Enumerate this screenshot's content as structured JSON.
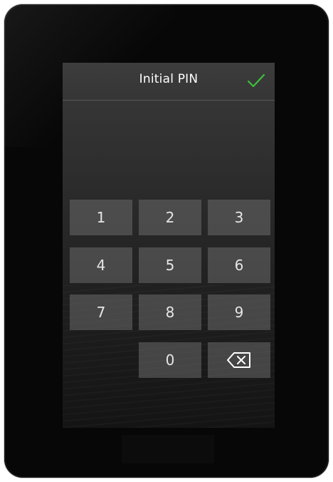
{
  "header": {
    "title": "Initial PIN",
    "confirm_icon": "checkmark-icon",
    "confirm_color": "#3cbf3c"
  },
  "pin_display": {
    "value": ""
  },
  "keypad": {
    "keys": [
      "1",
      "2",
      "3",
      "4",
      "5",
      "6",
      "7",
      "8",
      "9",
      "0"
    ],
    "backspace_icon": "backspace-icon"
  },
  "colors": {
    "device": "#070707",
    "screen": "#2b2b2b",
    "key": "#5a5a5a",
    "accent": "#3cbf3c"
  }
}
